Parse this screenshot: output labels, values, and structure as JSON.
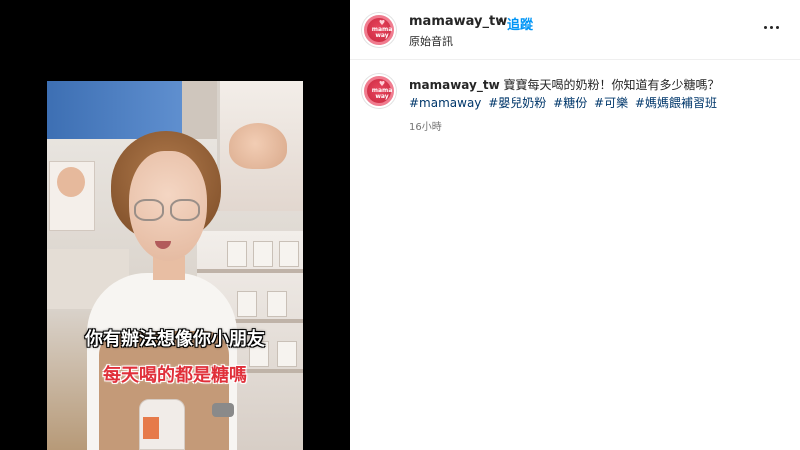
{
  "post": {
    "username": "mamaway_tw",
    "separator": "•",
    "follow_label": "追蹤",
    "audio_label": "原始音訊",
    "avatar_text": "mama way",
    "caption_username": "mamaway_tw",
    "caption_text": " 寶寶每天喝的奶粉！你知道有多少糖嗎？",
    "hashtags": [
      "#mamaway",
      "#嬰兒奶粉",
      "#糖份",
      "#可樂",
      "#媽媽餵補習班"
    ],
    "timestamp": "16小時",
    "more_icon": "more-horizontal-icon"
  },
  "video": {
    "subtitle_1": "你有辦法想像你小朋友",
    "subtitle_2": "每天喝的都是糖嗎"
  },
  "colors": {
    "link_blue": "#0095f6",
    "hashtag_blue": "#00376b",
    "brand_pink": "#e9465e",
    "subtitle_red": "#e0303a"
  }
}
